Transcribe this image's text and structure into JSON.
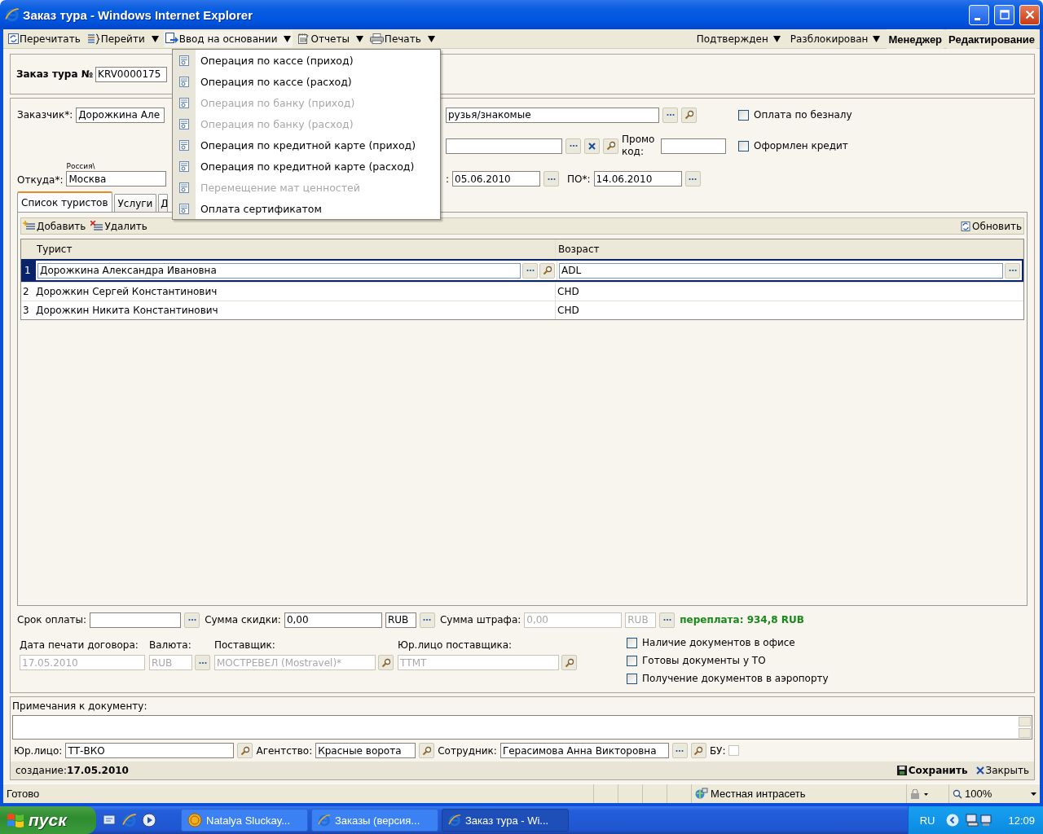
{
  "window": {
    "title": "Заказ тура - Windows Internet Explorer"
  },
  "toolbar": {
    "left": [
      {
        "label": "Перечитать",
        "dropdown": false,
        "expanded": false
      },
      {
        "label": "Перейти",
        "dropdown": true,
        "expanded": false
      },
      {
        "label": "Ввод на основании",
        "dropdown": true,
        "expanded": true
      },
      {
        "label": "Отчеты",
        "dropdown": true,
        "expanded": false
      },
      {
        "label": "Печать",
        "dropdown": true,
        "expanded": false
      }
    ],
    "right": [
      {
        "label": "Подтвержден",
        "kind": "menu"
      },
      {
        "label": "Разблокирован",
        "kind": "menu"
      },
      {
        "label": "Менеджер",
        "kind": "status"
      },
      {
        "label": "Редактирование",
        "kind": "status"
      }
    ]
  },
  "dropdown_menu": [
    {
      "label": "Операция по кассе (приход)",
      "disabled": false
    },
    {
      "label": "Операция по кассе (расход)",
      "disabled": false
    },
    {
      "label": "Операция по банку (приход)",
      "disabled": true
    },
    {
      "label": "Операция по банку (расход)",
      "disabled": true
    },
    {
      "label": "Операция по кредитной карте (приход)",
      "disabled": false
    },
    {
      "label": "Операция по кредитной карте (расход)",
      "disabled": false
    },
    {
      "label": "Перемещение мат ценностей",
      "disabled": true
    },
    {
      "label": "Оплата сертификатом",
      "disabled": false
    }
  ],
  "header": {
    "label": "Заказ тура №",
    "number": "KRV0000175"
  },
  "customer": {
    "label": "Заказчик*:",
    "value": "Дорожкина Але",
    "source": "рузья/знакомые"
  },
  "promo": {
    "label": "Промо код:"
  },
  "departure": {
    "hint": "Россия\\",
    "label": "Откуда*:",
    "value": "Москва"
  },
  "dates": {
    "from_label": ":",
    "from": "05.06.2010",
    "to_label": "ПО*:",
    "to": "14.06.2010"
  },
  "options": [
    {
      "label": "Оплата по безналу",
      "checked": false
    },
    {
      "label": "Оформлен кредит",
      "checked": false
    }
  ],
  "tabs": [
    {
      "label": "Список туристов",
      "selected": true
    },
    {
      "label": "Услуги",
      "selected": false
    },
    {
      "label": "Д",
      "selected": false
    }
  ],
  "tourists": {
    "actions": [
      "Добавить",
      "Удалить"
    ],
    "refresh": "Обновить",
    "columns": [
      "Турист",
      "Возраст"
    ],
    "rows": [
      {
        "index": "1",
        "name": "Дорожкина Александра Ивановна",
        "age": "ADL",
        "selected": true
      },
      {
        "index": "2",
        "name": "Дорожкин Сергей Константинович",
        "age": "CHD",
        "selected": false
      },
      {
        "index": "3",
        "name": "Дорожкин Никита Константинович",
        "age": "CHD",
        "selected": false
      }
    ]
  },
  "payment": [
    {
      "label": "Срок оплаты:",
      "disabled": false
    },
    {
      "label": "Сумма скидки:",
      "value": "0,00",
      "currency": "RUB",
      "disabled": false
    },
    {
      "label": "Сумма штрафа:",
      "value": "0,00",
      "currency": "RUB",
      "disabled": true
    }
  ],
  "overpayment": "переплата: 934,8 RUB",
  "contract": [
    {
      "label": "Дата печати договора:",
      "value": "17.05.2010",
      "kind": "plain"
    },
    {
      "label": "Валюта:",
      "value": "RUB",
      "kind": "ellipsis"
    },
    {
      "label": "Поставщик:",
      "value": "МОСТРЕВЕЛ (Mostravel)*",
      "kind": "search"
    },
    {
      "label": "Юр.лицо поставщика:",
      "value": "ТТМТ",
      "kind": "search"
    }
  ],
  "documents": [
    {
      "label": "Наличие документов в офисе",
      "checked": false
    },
    {
      "label": "Готовы документы у ТО",
      "checked": false
    },
    {
      "label": "Получение документов в аэропорту",
      "checked": false
    }
  ],
  "notes": {
    "label": "Примечания к документу:"
  },
  "footer_fields": [
    {
      "label": "Юр.лицо:",
      "value": "ТТ-ВКО",
      "ellipsis": false
    },
    {
      "label": "Агентство:",
      "value": "Красные ворота",
      "ellipsis": false
    },
    {
      "label": "Сотрудник:",
      "value": "Герасимова Анна Викторовна",
      "ellipsis": true
    }
  ],
  "accounting": {
    "label": "БУ:",
    "checked": false
  },
  "created": {
    "label": "создание:",
    "date": "17.05.2010"
  },
  "actions": [
    "Сохранить",
    "Закрыть"
  ],
  "status_bar": {
    "text": "Готово",
    "zone": "Местная интрасеть",
    "zoom": "100%"
  },
  "taskbar": {
    "start": "пуск",
    "tasks": [
      {
        "label": "Natalya Sluckay...",
        "selected": false
      },
      {
        "label": "Заказы (версия...",
        "selected": false
      },
      {
        "label": "Заказ тура - Wi...",
        "selected": true
      }
    ],
    "language": "RU",
    "clock": "12:09"
  }
}
